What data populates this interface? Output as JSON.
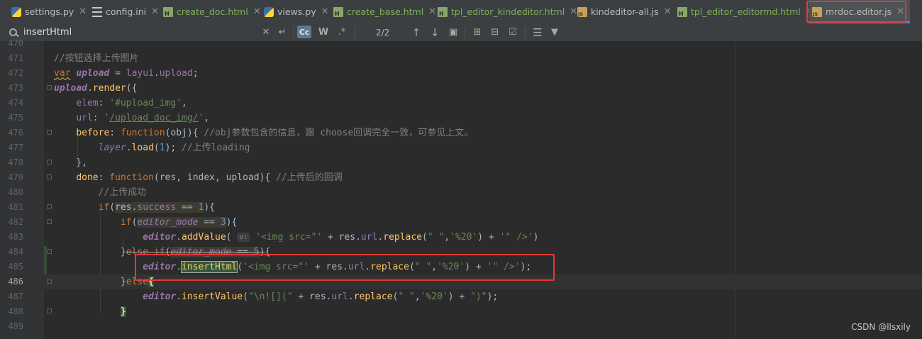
{
  "tabs": [
    {
      "icon": "python-file-icon",
      "label": "settings.py"
    },
    {
      "icon": "ini-file-icon",
      "label": "config.ini"
    },
    {
      "icon": "html-file-icon",
      "label": "create_doc.html"
    },
    {
      "icon": "python-file-icon",
      "label": "views.py"
    },
    {
      "icon": "html-file-icon",
      "label": "create_base.html"
    },
    {
      "icon": "html-file-icon",
      "label": "tpl_editor_kindeditor.html"
    },
    {
      "icon": "js-file-icon",
      "label": "kindeditor-all.js"
    },
    {
      "icon": "html-file-icon",
      "label": "tpl_editor_editormd.html"
    },
    {
      "icon": "js-file-icon",
      "label": "mrdoc.editor.js",
      "active": true
    }
  ],
  "find": {
    "query": "insertHtml",
    "match_case_label": "Cc",
    "words_label": "W",
    "regex_label": ".*",
    "match_count": "2/2"
  },
  "editor": {
    "line_numbers": [
      "470",
      "471",
      "472",
      "473",
      "474",
      "475",
      "476",
      "477",
      "478",
      "479",
      "480",
      "481",
      "482",
      "483",
      "484",
      "485",
      "486",
      "487",
      "488",
      "489"
    ],
    "current_line": "486",
    "inlay_hint": "v:"
  },
  "watermark": "CSDN @llsxily",
  "colors": {
    "highlight_box": "#e53935",
    "active_tab_underline": "#4a88c7",
    "editor_background": "#2b2b2b"
  }
}
